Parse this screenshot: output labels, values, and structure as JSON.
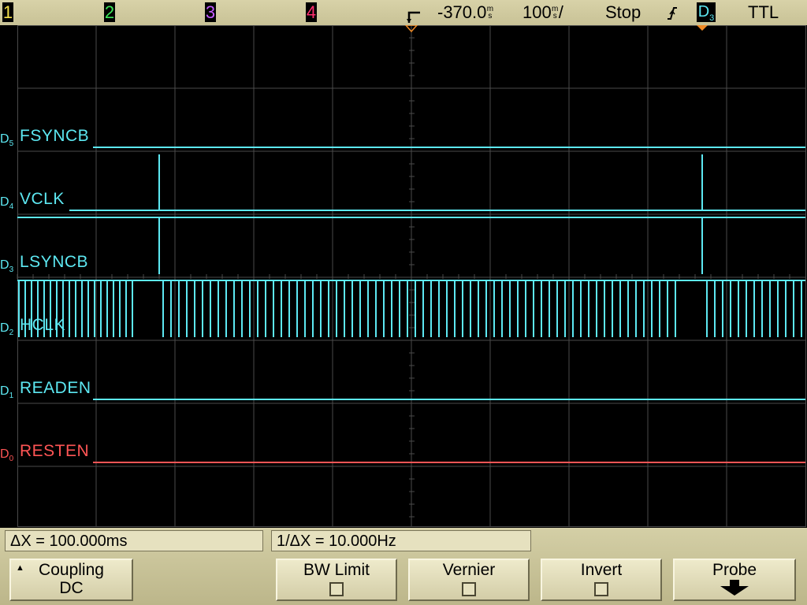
{
  "top_bar": {
    "channels": [
      {
        "label": "1",
        "color": "#f4e04a"
      },
      {
        "label": "2",
        "color": "#3ee65a"
      },
      {
        "label": "3",
        "color": "#c45cff"
      },
      {
        "label": "4",
        "color": "#ff2e6e"
      }
    ],
    "trigger_marker_icon": "trigger-position-icon",
    "time_delay": "-370.0",
    "time_delay_unit": [
      "m",
      "s"
    ],
    "time_scale": "100",
    "time_scale_unit": [
      "m",
      "s"
    ],
    "time_scale_suffix": "/",
    "run_state": "Stop",
    "trigger_edge_icon": "rising-edge-icon",
    "trigger_source": "D",
    "trigger_source_index": "3",
    "trigger_level": "TTL"
  },
  "digital_channels": [
    {
      "id": "D",
      "index": "5",
      "name": "FSYNCB",
      "color": "#5de8f2"
    },
    {
      "id": "D",
      "index": "4",
      "name": "VCLK",
      "color": "#5de8f2"
    },
    {
      "id": "D",
      "index": "3",
      "name": "LSYNCB",
      "color": "#5de8f2"
    },
    {
      "id": "D",
      "index": "2",
      "name": "HCLK",
      "color": "#5de8f2"
    },
    {
      "id": "D",
      "index": "1",
      "name": "READEN",
      "color": "#5de8f2"
    },
    {
      "id": "D",
      "index": "0",
      "name": "RESTEN",
      "color": "#ff5555"
    }
  ],
  "measurements": {
    "delta_x": "ΔX = 100.000ms",
    "inv_delta_x": "1/ΔX = 10.000Hz"
  },
  "softkeys": {
    "coupling_title": "Coupling",
    "coupling_value": "DC",
    "bw_limit": "BW Limit",
    "vernier": "Vernier",
    "invert": "Invert",
    "probe": "Probe"
  },
  "colors": {
    "trace_cyan": "#5de8f2",
    "trace_red": "#ff5555",
    "grid": "#4a4a4a",
    "marker_orange": "#f08a24"
  }
}
